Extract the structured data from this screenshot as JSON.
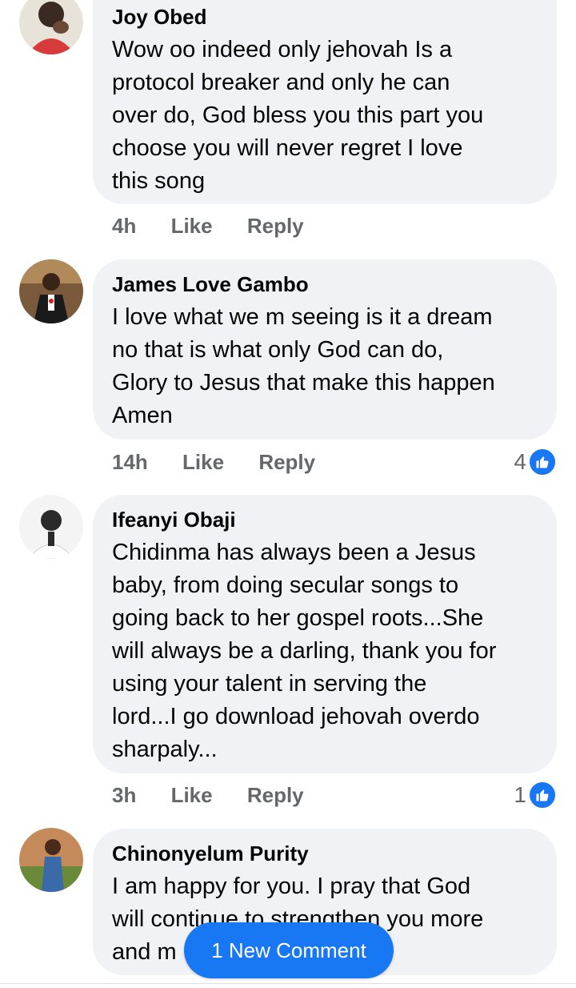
{
  "colors": {
    "bubble_bg": "#f0f2f5",
    "meta_text": "#65676b",
    "accent_blue": "#1877f2",
    "text_primary": "#050505"
  },
  "comments": [
    {
      "author": "Joy Obed",
      "text": "Wow oo indeed only jehovah Is a\nprotocol breaker and only he can\nover do, God bless you this part you\nchoose you will never regret I love\nthis song",
      "time": "4h",
      "like_label": "Like",
      "reply_label": "Reply",
      "reactions": ""
    },
    {
      "author": "James Love Gambo",
      "text": "I love what we m seeing is it a dream\nno that is what only God can do,\nGlory to Jesus that make this happen\nAmen",
      "time": "14h",
      "like_label": "Like",
      "reply_label": "Reply",
      "reactions": "4"
    },
    {
      "author": "Ifeanyi Obaji",
      "text": "Chidinma has always been a Jesus\nbaby,  from doing secular songs to\ngoing back to her gospel roots...She\nwill always be a darling, thank you for\nusing your talent in serving the\nlord...I go download jehovah overdo\nsharpaly...",
      "time": "3h",
      "like_label": "Like",
      "reply_label": "Reply",
      "reactions": "1"
    },
    {
      "author": "Chinonyelum Purity",
      "text": "I am happy for you. I pray that God\nwill continue to  strengthen you more\nand m",
      "time": "",
      "like_label": "",
      "reply_label": "",
      "reactions": ""
    }
  ],
  "new_comment_pill": "1 New Comment"
}
